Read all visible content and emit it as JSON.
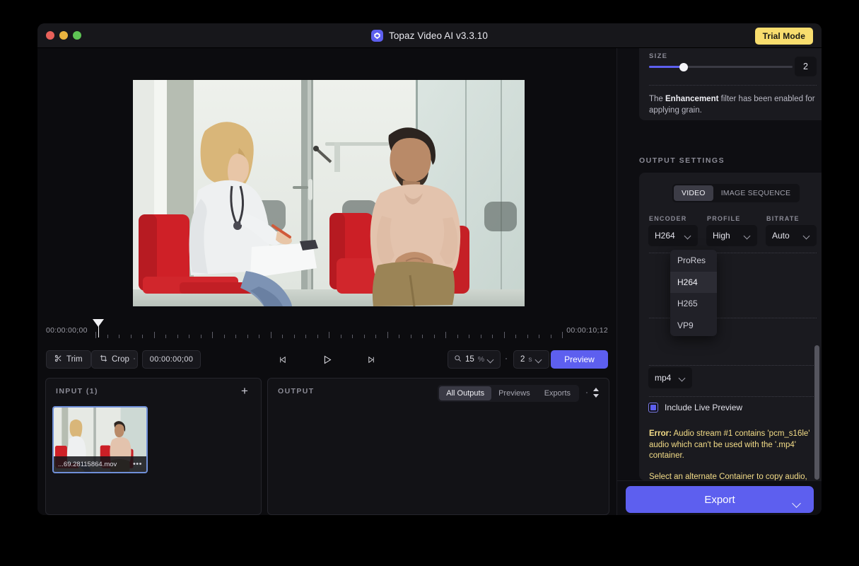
{
  "window": {
    "title": "Topaz Video AI  v3.3.10",
    "logo_icon": "topaz-logo-icon",
    "trial_badge": "Trial Mode",
    "traffic_lights": {
      "close": "close-window",
      "minimize": "minimize-window",
      "maximize": "maximize-window"
    }
  },
  "viewer": {
    "frame_description": "Medical consultation: doctor with clipboard seated in red armchair talking with a patient"
  },
  "timeline": {
    "start_timecode": "00:00:00;00",
    "end_timecode": "00:00:10;12",
    "playhead_position_percent": 0
  },
  "controls": {
    "trim_label": "Trim",
    "trim_icon": "scissors-icon",
    "crop_label": "Crop",
    "crop_icon": "crop-icon",
    "current_timecode": "00:00:00;00",
    "prev_frame_icon": "previous-frame-icon",
    "play_icon": "play-icon",
    "next_frame_icon": "next-frame-icon",
    "zoom_icon": "magnifier-icon",
    "zoom_value": "15",
    "zoom_unit": "%",
    "duration_value": "2",
    "duration_unit": "s",
    "preview_label": "Preview"
  },
  "input_pane": {
    "title": "INPUT (1)",
    "add_icon": "plus-icon",
    "items": [
      {
        "filename": "...69.28115864.mov",
        "menu_icon": "ellipsis-icon",
        "selected": true
      }
    ]
  },
  "output_pane": {
    "title": "OUTPUT",
    "filters": [
      {
        "label": "All Outputs",
        "active": true
      },
      {
        "label": "Previews",
        "active": false
      },
      {
        "label": "Exports",
        "active": false
      }
    ],
    "sort_icon": "sort-updown-icon"
  },
  "sidebar": {
    "enhancement": {
      "size_label": "SIZE",
      "size_value": "2",
      "slider_percent": 24,
      "note_prefix": "The ",
      "note_bold": "Enhancement",
      "note_suffix": " filter has been enabled for applying grain."
    },
    "output_settings": {
      "section_title": "OUTPUT SETTINGS",
      "mode_tabs": [
        {
          "label": "VIDEO",
          "active": true
        },
        {
          "label": "IMAGE SEQUENCE",
          "active": false
        }
      ],
      "encoder_label": "ENCODER",
      "encoder_value": "H264",
      "profile_label": "PROFILE",
      "profile_value": "High",
      "bitrate_label": "BITRATE",
      "bitrate_value": "Auto",
      "container_value": "mp4",
      "encoder_options": [
        {
          "label": "ProRes",
          "selected": false
        },
        {
          "label": "H264",
          "selected": true
        },
        {
          "label": "H265",
          "selected": false
        },
        {
          "label": "VP9",
          "selected": false
        }
      ],
      "live_preview_label": "Include Live Preview",
      "live_preview_checked": true,
      "error_bold": "Error:",
      "error_text": " Audio stream #1 contains 'pcm_s16le' audio which can't be used with the '.mp4' container.",
      "error_hint": "Select an alternate Container to copy audio, or change Audio Mode to 'Convert' (this may cause a loss in audio quality)."
    },
    "export": {
      "label": "Export",
      "caret_icon": "chevron-down-icon"
    }
  },
  "colors": {
    "accent": "#5d5fef",
    "trial_badge": "#f8dd6e",
    "error_text": "#f4dd88",
    "window_bg": "#0e0e11"
  }
}
